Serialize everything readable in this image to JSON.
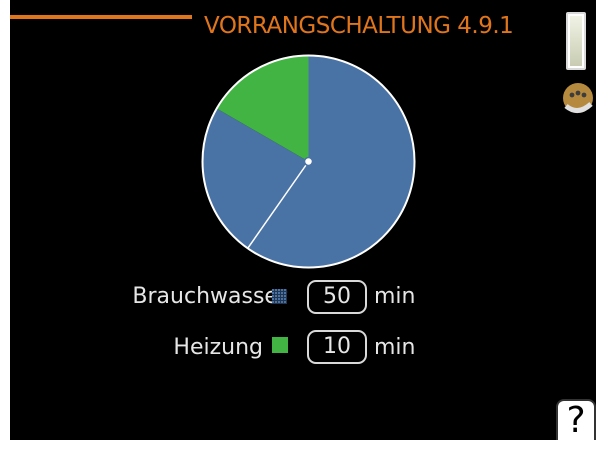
{
  "header": {
    "title": "VORRANGSCHALTUNG 4.9.1"
  },
  "colors": {
    "accent": "#e0751c",
    "hot_water": "#4a73a5",
    "heating": "#41b443",
    "text": "#e6e6e6"
  },
  "chart_data": {
    "type": "pie",
    "slices": [
      {
        "label": "Brauchwasser",
        "value": 50,
        "color": "#4a73a5"
      },
      {
        "label": "Heizung",
        "value": 10,
        "color": "#41b443"
      }
    ]
  },
  "settings": [
    {
      "label": "Brauchwasser",
      "value": "50",
      "unit": "min",
      "swatch_icon": "dotted-blue-square-icon"
    },
    {
      "label": "Heizung",
      "value": "10",
      "unit": "min",
      "swatch_icon": "green-square-icon"
    }
  ],
  "help": {
    "label": "?"
  },
  "icons": {
    "navigation": "control-knob-icon",
    "scroll": "scrollbar-icon"
  }
}
